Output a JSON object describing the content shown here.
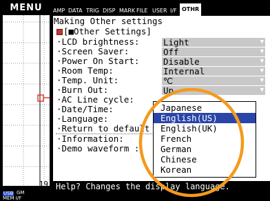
{
  "menu_label": "MENU",
  "tabs": [
    {
      "label": "AMP"
    },
    {
      "label": "DATA"
    },
    {
      "label": "TRIG"
    },
    {
      "label": "DISP"
    },
    {
      "label": "MARK"
    },
    {
      "label": "FILE"
    },
    {
      "label": "USER"
    },
    {
      "label": "I/F"
    },
    {
      "label": "OTHR"
    }
  ],
  "active_tab": "OTHR",
  "heading": "Making Other settings",
  "section_title": "[■Other Settings]",
  "settings": [
    {
      "label": "·LCD brightness:",
      "value": "Light"
    },
    {
      "label": "·Screen Saver:",
      "value": "Off"
    },
    {
      "label": "·Power On Start:",
      "value": "Disable"
    },
    {
      "label": "·Room Temp:",
      "value": "Internal"
    },
    {
      "label": "·Temp. Unit:",
      "value": "℃"
    },
    {
      "label": "·Burn Out:",
      "value": "Up"
    },
    {
      "label": "·AC Line cycle:",
      "value": ""
    },
    {
      "label": "·Date/Time:",
      "value": ""
    },
    {
      "label": "·Language:",
      "value": ""
    },
    {
      "label": "·Return to default",
      "value": ""
    },
    {
      "label": "·Information:",
      "value": ""
    },
    {
      "label": "·Demo waveform :",
      "value": ""
    }
  ],
  "language_dropdown": {
    "options": [
      "Japanese",
      "English(US)",
      "English(UK)",
      "French",
      "German",
      "Chinese",
      "Korean"
    ],
    "selected": "English(US)"
  },
  "help_text": "Help? Changes the display language.",
  "left_panel": {
    "count_value": "19",
    "status_top": "USB",
    "status_mid": "GM",
    "status_bottom": "MEM I/F"
  },
  "colors": {
    "selected_option": "#2a45a8",
    "annotation_ring": "#f39a1e",
    "trace_marker": "#e03020",
    "panel_bg": "#000000"
  }
}
